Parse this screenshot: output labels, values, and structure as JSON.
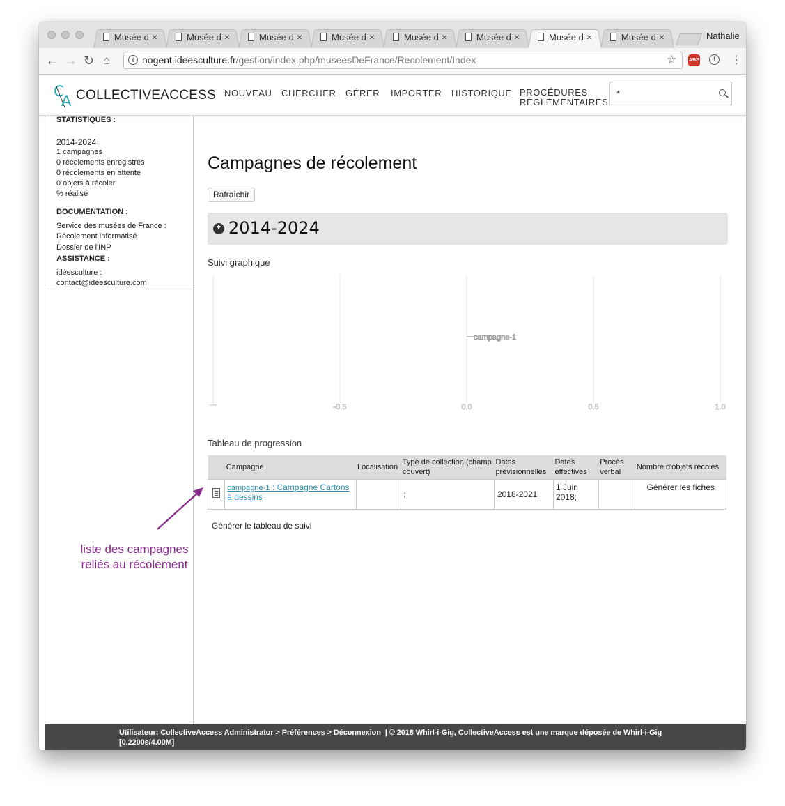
{
  "browser": {
    "tabs": [
      {
        "title": "Musée d"
      },
      {
        "title": "Musée d"
      },
      {
        "title": "Musée d"
      },
      {
        "title": "Musée d"
      },
      {
        "title": "Musée d"
      },
      {
        "title": "Musée d"
      },
      {
        "title": "Musée d",
        "active": true
      },
      {
        "title": "Musée d"
      }
    ],
    "close_glyph": "×",
    "profile": "Nathalie",
    "url_host": "nogent.ideesculture.fr",
    "url_path": "/gestion/index.php/museesDeFrance/Recolement/Index",
    "extension_label": "ABP"
  },
  "app": {
    "logo_text": "COLLECTIVEACCESS",
    "logo_c": "C",
    "logo_a": "A",
    "nav": [
      "NOUVEAU",
      "CHERCHER",
      "GÉRER",
      "IMPORTER",
      "HISTORIQUE"
    ],
    "nav_last_line1": "PROCÉDURES",
    "nav_last_line2": "RÉGLEMENTAIRES",
    "search_value": "*"
  },
  "sidebar": {
    "stats_heading": "STATISTIQUES :",
    "period": "2014-2024",
    "stats": [
      "1 campagnes",
      "0 récolements enregistrés",
      "0 récolements en attente",
      "0 objets à récoler",
      "% réalisé"
    ],
    "doc_heading": "DOCUMENTATION :",
    "doc_lines": [
      "Service des musées de France :",
      "Récolement informatisé",
      "Dossier de l'INP"
    ],
    "assist_heading": "ASSISTANCE :",
    "assist_lines": [
      "idéesculture :",
      "contact@ideesculture.com"
    ]
  },
  "main": {
    "title": "Campagnes de récolement",
    "refresh_label": "Rafraîchir",
    "year": "2014-2024",
    "chart_section": "Suivi graphique",
    "table_section": "Tableau de progression",
    "generate_table_label": "Générer le tableau de suivi"
  },
  "chart_data": {
    "type": "scatter",
    "x_ticks": [
      "-0.5",
      "0.0",
      "0.5",
      "1.0"
    ],
    "left_tick": "-∞",
    "xlim": [
      -1.0,
      1.0
    ],
    "grid": true,
    "points": [
      {
        "label": "campagne-1",
        "x": 0.0
      }
    ]
  },
  "table": {
    "headers": [
      "Campagne",
      "Localisation",
      "Type de collection (champ couvert)",
      "Dates prévisionnelles",
      "Dates effectives",
      "Procès verbal",
      "Nombre d'objets récolés"
    ],
    "rows": [
      {
        "code": "campagne-1",
        "sep": " : ",
        "name": "Campagne Cartons à dessins",
        "localisation": "",
        "type": ";",
        "dates_prev": "2018-2021",
        "dates_eff": "1 Juin 2018;",
        "proces_verbal": "",
        "action": "Générer les fiches"
      }
    ]
  },
  "annotation": {
    "line1": "liste des campagnes",
    "line2": "reliés au récolement",
    "color": "#8a2b8e"
  },
  "footer": {
    "user_prefix": "Utilisateur: CollectiveAccess Administrator",
    "gt": ">",
    "prefs": "Préférences",
    "logout": "Déconnexion",
    "copyright_prefix": "|  © 2018 Whirl-i-Gig,",
    "ca_link": "CollectiveAccess",
    "trademark": "est une marque déposée de",
    "wig_link": "Whirl-i-Gig",
    "stats": "[0.2200s/4.00M]"
  }
}
